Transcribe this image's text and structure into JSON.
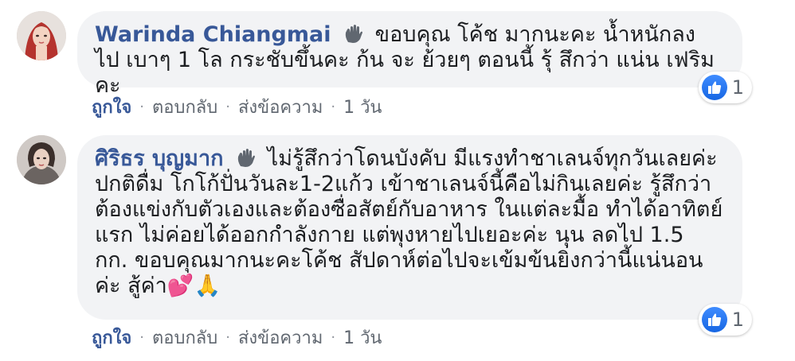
{
  "comments": [
    {
      "author": "Warinda Chiangmai",
      "text": "ขอบคุณ โค้ช มากนะคะ น้ำหนักลง ไป เบาๆ 1 โล กระชับขึ้นคะ ก้น จะ ย้วยๆ ตอนนี้ รุ้ สึกว่า แน่น เฟริมคะ",
      "reaction_count": "1",
      "actions": {
        "like": "ถูกใจ",
        "reply": "ตอบกลับ",
        "message": "ส่งข้อความ",
        "time": "1 วัน"
      }
    },
    {
      "author": "ศิริธร บุญมาก",
      "text": "ไม่รู้สึกว่าโดนบังคับ มีแรงทำชาเลนจ์ทุกวันเลยค่ะ ปกติดื่ม โกโก้ปั่นวันละ1-2แก้ว เข้าชาเลนจ์นี้คือไม่กินเลยค่ะ รู้สึกว่าต้องแข่งกับตัวเองและต้องซื่อสัตย์กับอาหาร ในแต่ละมื้อ ทำได้อาทิตย์แรก ไม่ค่อยได้ออกกำลังกาย แต่พุงหายไปเยอะค่ะ นุน ลดไป 1.5 กก. ขอบคุณมากนะคะโค้ช สัปดาห์ต่อไปจะเข้มข้นยิ่งกว่านี้แน่นอนค่ะ สู้ค่า",
      "emojis": "💕🙏",
      "reaction_count": "1",
      "actions": {
        "like": "ถูกใจ",
        "reply": "ตอบกลับ",
        "message": "ส่งข้อความ",
        "time": "1 วัน"
      }
    }
  ],
  "colors": {
    "author": "#385898",
    "bubble": "#f2f3f5",
    "meta": "#606770",
    "like_blue": "#1766e3"
  },
  "icons": {
    "badge": "hand-wave-icon",
    "reaction": "thumbs-up-icon"
  }
}
